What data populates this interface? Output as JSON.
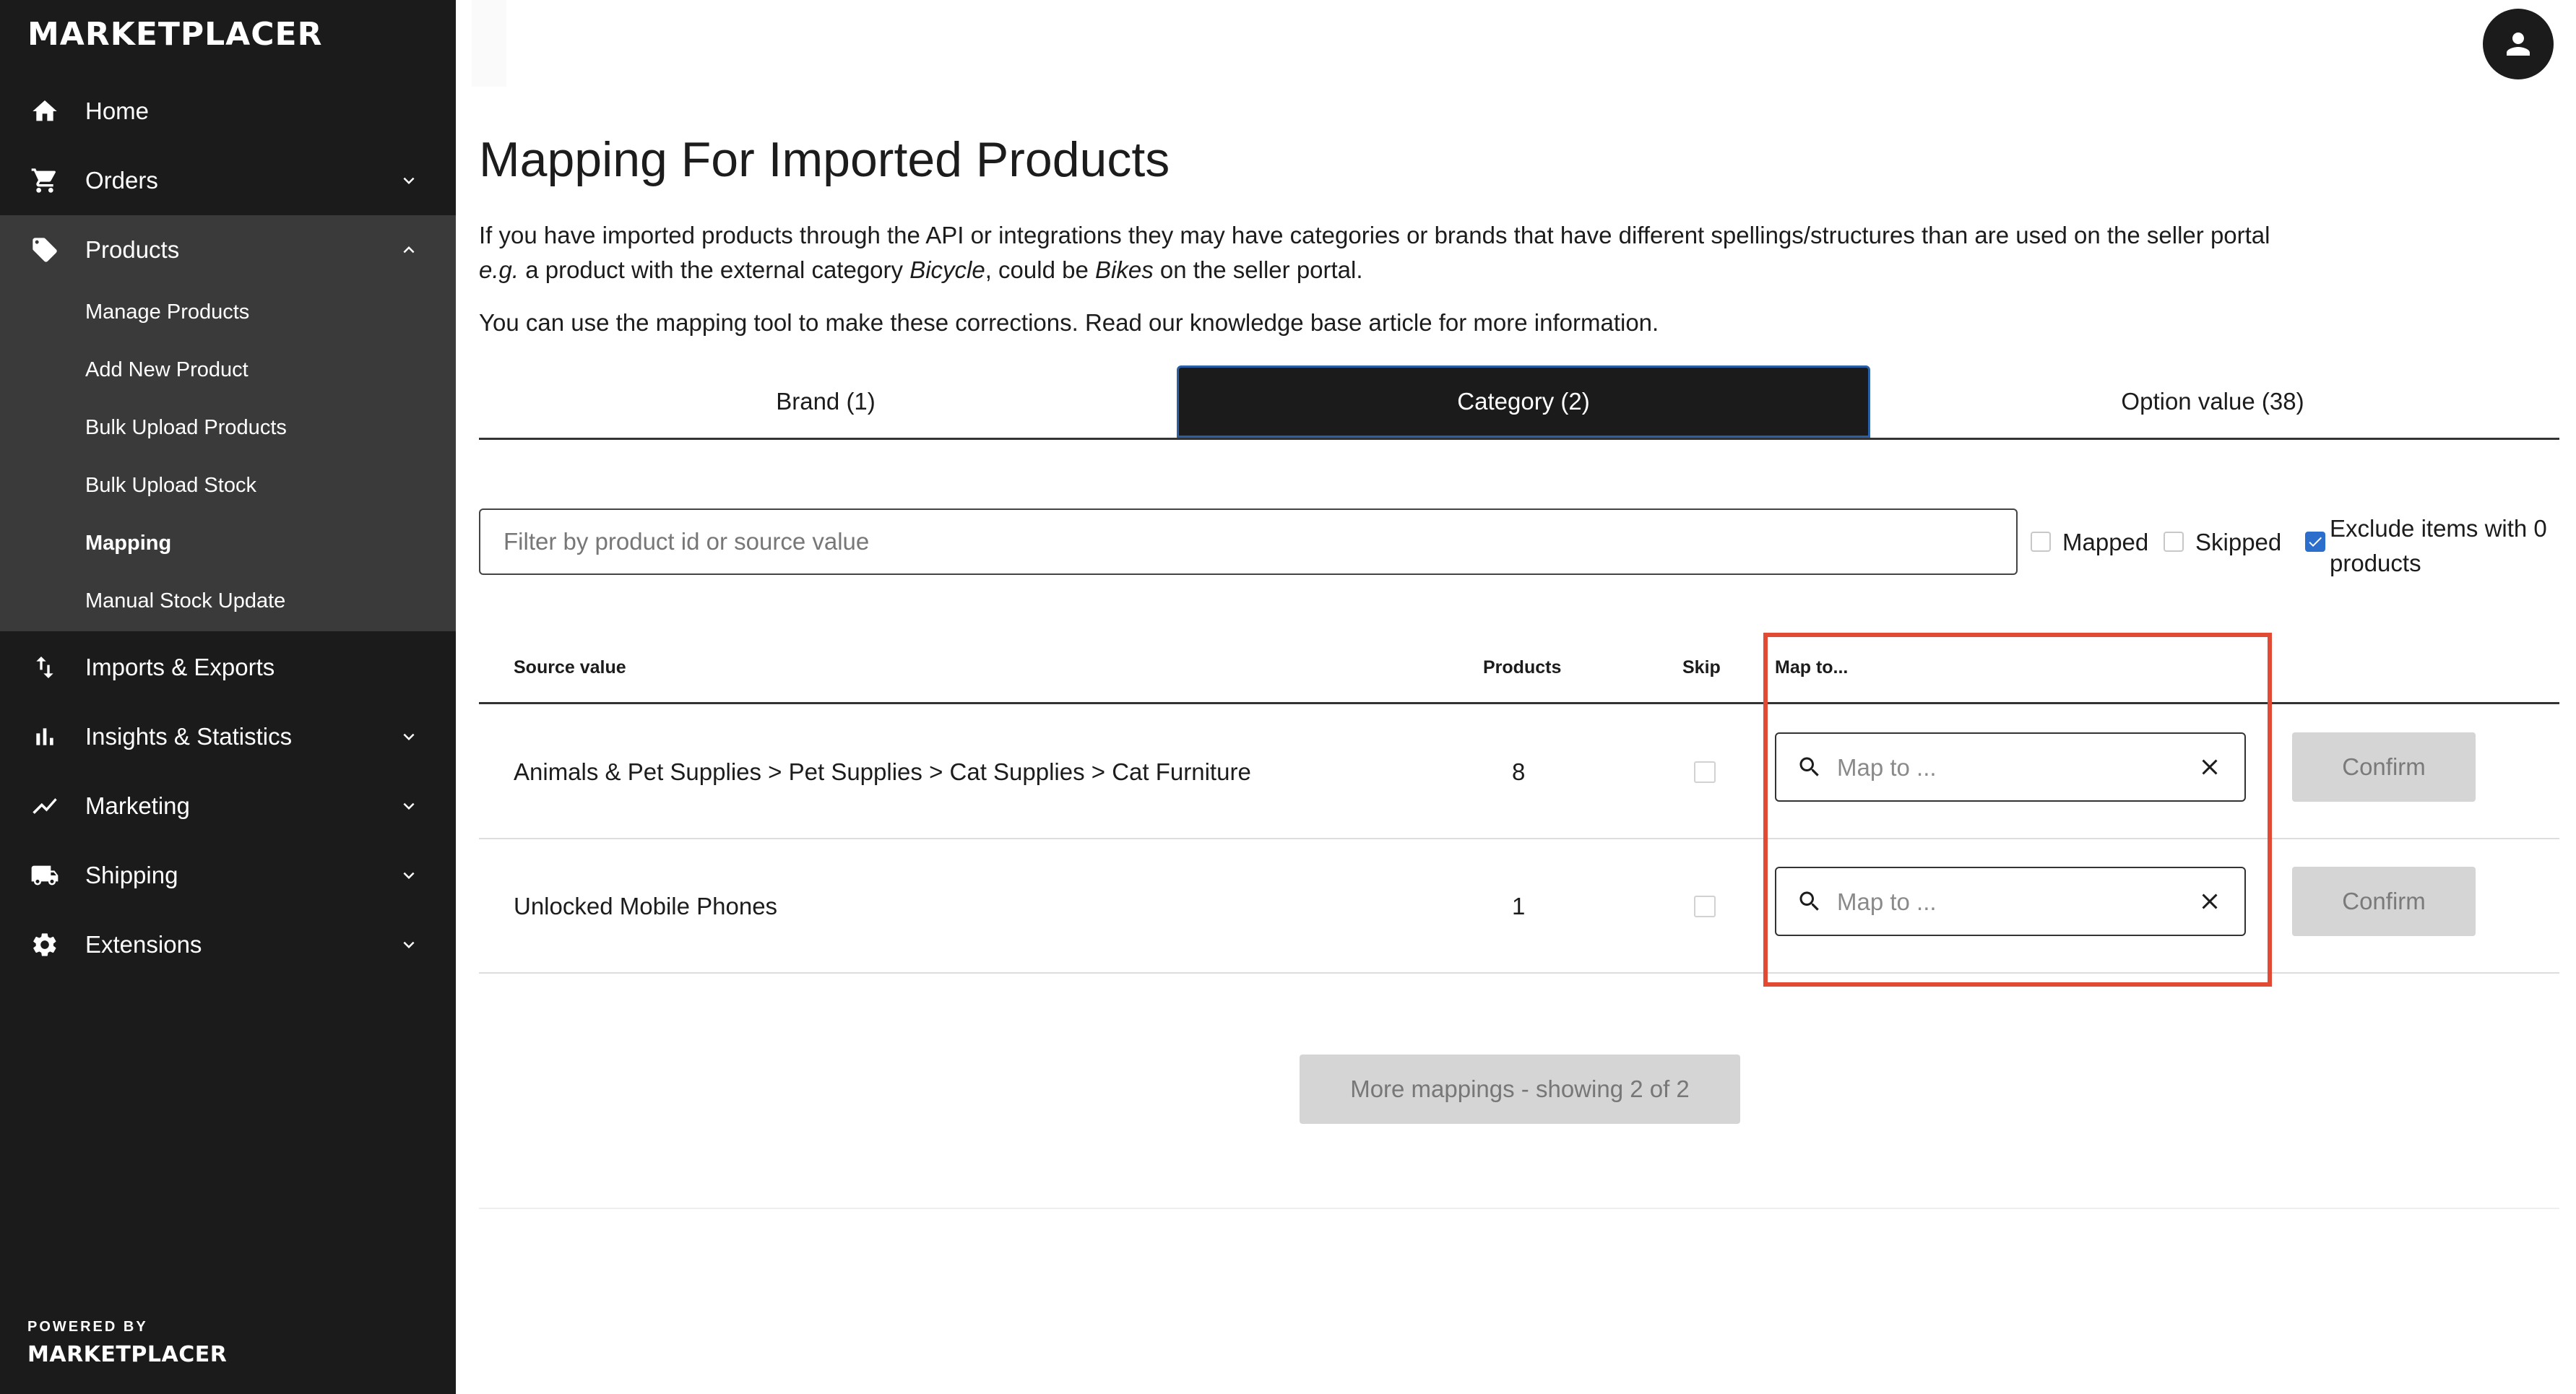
{
  "brand": {
    "logo": "MARKETPLACER",
    "powered_by": "POWERED BY",
    "footer_logo": "MARKETPLACER"
  },
  "nav": [
    {
      "label": "Home",
      "icon": "home-icon"
    },
    {
      "label": "Orders",
      "icon": "cart-icon"
    },
    {
      "label": "Products",
      "icon": "tag-icon"
    },
    {
      "label": "Imports & Exports",
      "icon": "import-export-icon"
    },
    {
      "label": "Insights & Statistics",
      "icon": "bar-chart-icon"
    },
    {
      "label": "Marketing",
      "icon": "trend-icon"
    },
    {
      "label": "Shipping",
      "icon": "truck-icon"
    },
    {
      "label": "Extensions",
      "icon": "gear-icon"
    }
  ],
  "products_sub": [
    "Manage Products",
    "Add New Product",
    "Bulk Upload Products",
    "Bulk Upload Stock",
    "Mapping",
    "Manual Stock Update"
  ],
  "page": {
    "title": "Mapping For Imported Products",
    "intro_line1": "If you have imported products through the API or integrations they may have categories or brands that have different spellings/structures than are used on the seller portal",
    "intro_eg": "e.g.",
    "intro_mid1": " a product with the external category ",
    "intro_bicycle": "Bicycle",
    "intro_mid2": ", could be ",
    "intro_bikes": "Bikes",
    "intro_end": " on the seller portal.",
    "intro_line2": "You can use the mapping tool to make these corrections. Read our knowledge base article for more information."
  },
  "tabs": [
    "Brand (1)",
    "Category (2)",
    "Option value (38)"
  ],
  "filter": {
    "placeholder": "Filter by product id or source value",
    "mapped_label": "Mapped",
    "skipped_label": "Skipped",
    "exclude_label_1": "Exclude items with 0",
    "exclude_label_2": "products"
  },
  "table": {
    "headers": {
      "source": "Source value",
      "products": "Products",
      "skip": "Skip",
      "map": "Map to..."
    },
    "rows": [
      {
        "source": "Animals & Pet Supplies > Pet Supplies > Cat Supplies > Cat Furniture",
        "products": "8"
      },
      {
        "source": "Unlocked Mobile Phones",
        "products": "1"
      }
    ],
    "map_placeholder": "Map to ...",
    "confirm_label": "Confirm"
  },
  "more_button": "More mappings - showing 2 of 2",
  "colors": {
    "sidebar": "#1b1b1b",
    "active_tab_border": "#2b5fa6",
    "highlight": "#e34a33",
    "check_blue": "#2c6ecb"
  }
}
